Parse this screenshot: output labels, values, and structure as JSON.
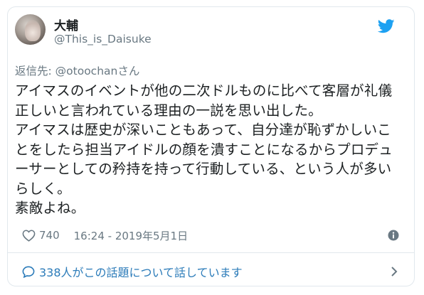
{
  "author": {
    "display_name": "大輔",
    "screen_name": "@This_is_Daisuke",
    "avatar_icon": "user-avatar"
  },
  "reply_to": "返信先: @otoochanさん",
  "tweet": {
    "text": "アイマスのイベントが他の二次ドルものに比べて客層が礼儀正しいと言われている理由の一説を思い出した。\nアイマスは歴史が深いこともあって、自分達が恥ずかしいことをしたら担当アイドルの顔を潰すことになるからプロデューサーとしての矜持を持って行動している、という人が多いらしく。\n素敵よね。"
  },
  "meta": {
    "like_count": "740",
    "timestamp": "16:24 - 2019年5月1日"
  },
  "conversation": {
    "label": "338人がこの話題について話しています"
  },
  "colors": {
    "text": "#1c2022",
    "secondary": "#697882",
    "link": "#2b7bb9",
    "twitter_blue": "#1da1f2",
    "border": "#e1e8ed"
  },
  "icons": {
    "brand": "twitter-bird-icon",
    "like": "heart-icon",
    "info": "info-icon",
    "conversation": "speech-bubble-icon",
    "chevron": "chevron-right-icon"
  }
}
